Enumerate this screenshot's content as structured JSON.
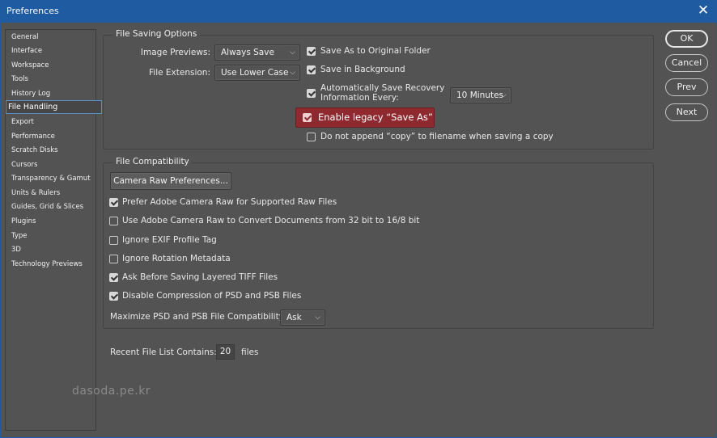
{
  "window": {
    "title": "Preferences",
    "close_glyph": "✕"
  },
  "sidebar": {
    "items": [
      {
        "label": "General"
      },
      {
        "label": "Interface"
      },
      {
        "label": "Workspace"
      },
      {
        "label": "Tools"
      },
      {
        "label": "History Log"
      },
      {
        "label": "File Handling",
        "active": true
      },
      {
        "label": "Export"
      },
      {
        "label": "Performance"
      },
      {
        "label": "Scratch Disks"
      },
      {
        "label": "Cursors"
      },
      {
        "label": "Transparency & Gamut"
      },
      {
        "label": "Units & Rulers"
      },
      {
        "label": "Guides, Grid & Slices"
      },
      {
        "label": "Plugins"
      },
      {
        "label": "Type"
      },
      {
        "label": "3D"
      },
      {
        "label": "Technology Previews"
      }
    ]
  },
  "file_saving": {
    "group_label": "File Saving Options",
    "image_previews_label": "Image Previews:",
    "image_previews_value": "Always Save",
    "file_extension_label": "File Extension:",
    "file_extension_value": "Use Lower Case",
    "save_as_original_label": "Save As to Original Folder",
    "save_as_original_checked": true,
    "save_in_background_label": "Save in Background",
    "save_in_background_checked": true,
    "auto_recovery_label_1": "Automatically Save Recovery",
    "auto_recovery_label_2": "Information Every:",
    "auto_recovery_checked": true,
    "auto_recovery_interval": "10 Minutes",
    "legacy_save_as_label": "Enable legacy “Save As”",
    "legacy_save_as_checked": true,
    "no_copy_label": "Do not append “copy” to filename when saving a copy",
    "no_copy_checked": false
  },
  "file_compat": {
    "group_label": "File Compatibility",
    "camera_raw_button": "Camera Raw Preferences...",
    "options": [
      {
        "label": "Prefer Adobe Camera Raw for Supported Raw Files",
        "checked": true
      },
      {
        "label": "Use Adobe Camera Raw to Convert Documents from 32 bit to 16/8 bit",
        "checked": false
      },
      {
        "label": "Ignore EXIF Profile Tag",
        "checked": false
      },
      {
        "label": "Ignore Rotation Metadata",
        "checked": false
      },
      {
        "label": "Ask Before Saving Layered TIFF Files",
        "checked": true
      },
      {
        "label": "Disable Compression of PSD and PSB Files",
        "checked": true
      }
    ],
    "maximize_label": "Maximize PSD and PSB File Compatibility:",
    "maximize_value": "Ask"
  },
  "recent": {
    "label": "Recent File List Contains:",
    "value": "20",
    "suffix": "files"
  },
  "buttons": {
    "ok": "OK",
    "cancel": "Cancel",
    "prev": "Prev",
    "next": "Next"
  },
  "watermark": "dasoda.pe.kr",
  "colors": {
    "titlebar": "#1e5ba0",
    "panel": "#535353",
    "highlight": "#8e2a2f",
    "selection_border": "#5b8fc7"
  }
}
